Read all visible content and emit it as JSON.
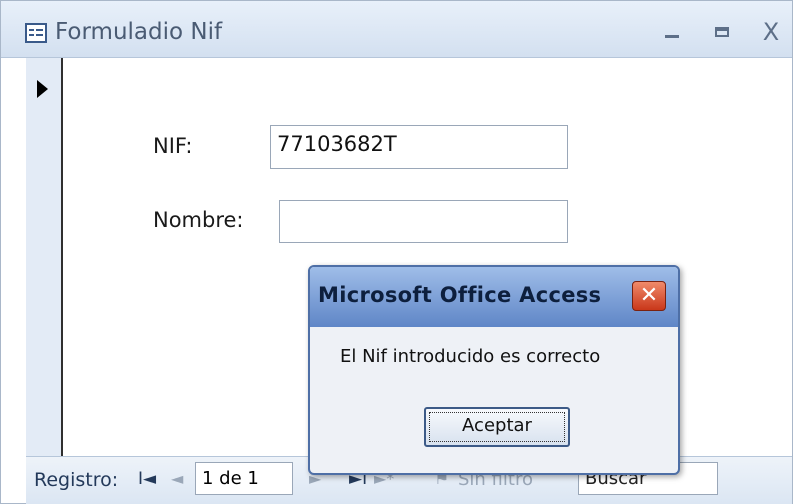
{
  "window": {
    "title": "Formuladio Nif",
    "minimize_glyph": "_",
    "maximize_glyph": "□",
    "close_glyph": "X"
  },
  "form": {
    "nif_label": "NIF:",
    "nif_value": "77103682T",
    "nombre_label": "Nombre:",
    "nombre_value": ""
  },
  "navigation": {
    "record_label": "Registro:",
    "first_glyph": "I◄",
    "prev_glyph": "◄",
    "record_position": "1 de 1",
    "next_glyph": "►",
    "last_glyph": "►I",
    "new_glyph": "►*",
    "filter_label": "Sin filtro",
    "search_label": "Buscar"
  },
  "dialog": {
    "title": "Microsoft Office Access",
    "close_glyph": "✕",
    "message": "El Nif introducido es correcto",
    "ok_label": "Aceptar"
  },
  "colors": {
    "titlebar": "#d3e0f0",
    "dialog_titlebar": "#5f86c7",
    "dialog_close": "#c9371a"
  }
}
